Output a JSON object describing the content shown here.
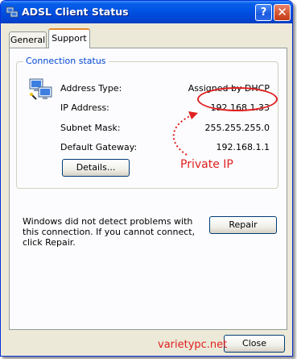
{
  "window": {
    "title": "ADSL Client Status",
    "help_glyph": "?",
    "close_glyph": "✕"
  },
  "tabs": [
    {
      "label": "General"
    },
    {
      "label": "Support"
    }
  ],
  "connection_status": {
    "group_label": "Connection status",
    "rows": [
      {
        "label": "Address Type:",
        "value": "Assigned by DHCP"
      },
      {
        "label": "IP Address:",
        "value": "192.168.1.33"
      },
      {
        "label": "Subnet Mask:",
        "value": "255.255.255.0"
      },
      {
        "label": "Default Gateway:",
        "value": "192.168.1.1"
      }
    ],
    "details_label": "Details..."
  },
  "diagnostics": {
    "message": "Windows did not detect problems with this connection. If you cannot connect, click Repair.",
    "repair_label": "Repair"
  },
  "footer": {
    "close_label": "Close"
  },
  "annotation": {
    "label": "Private IP",
    "color": "#e02020"
  },
  "watermark": "varietypc.net"
}
